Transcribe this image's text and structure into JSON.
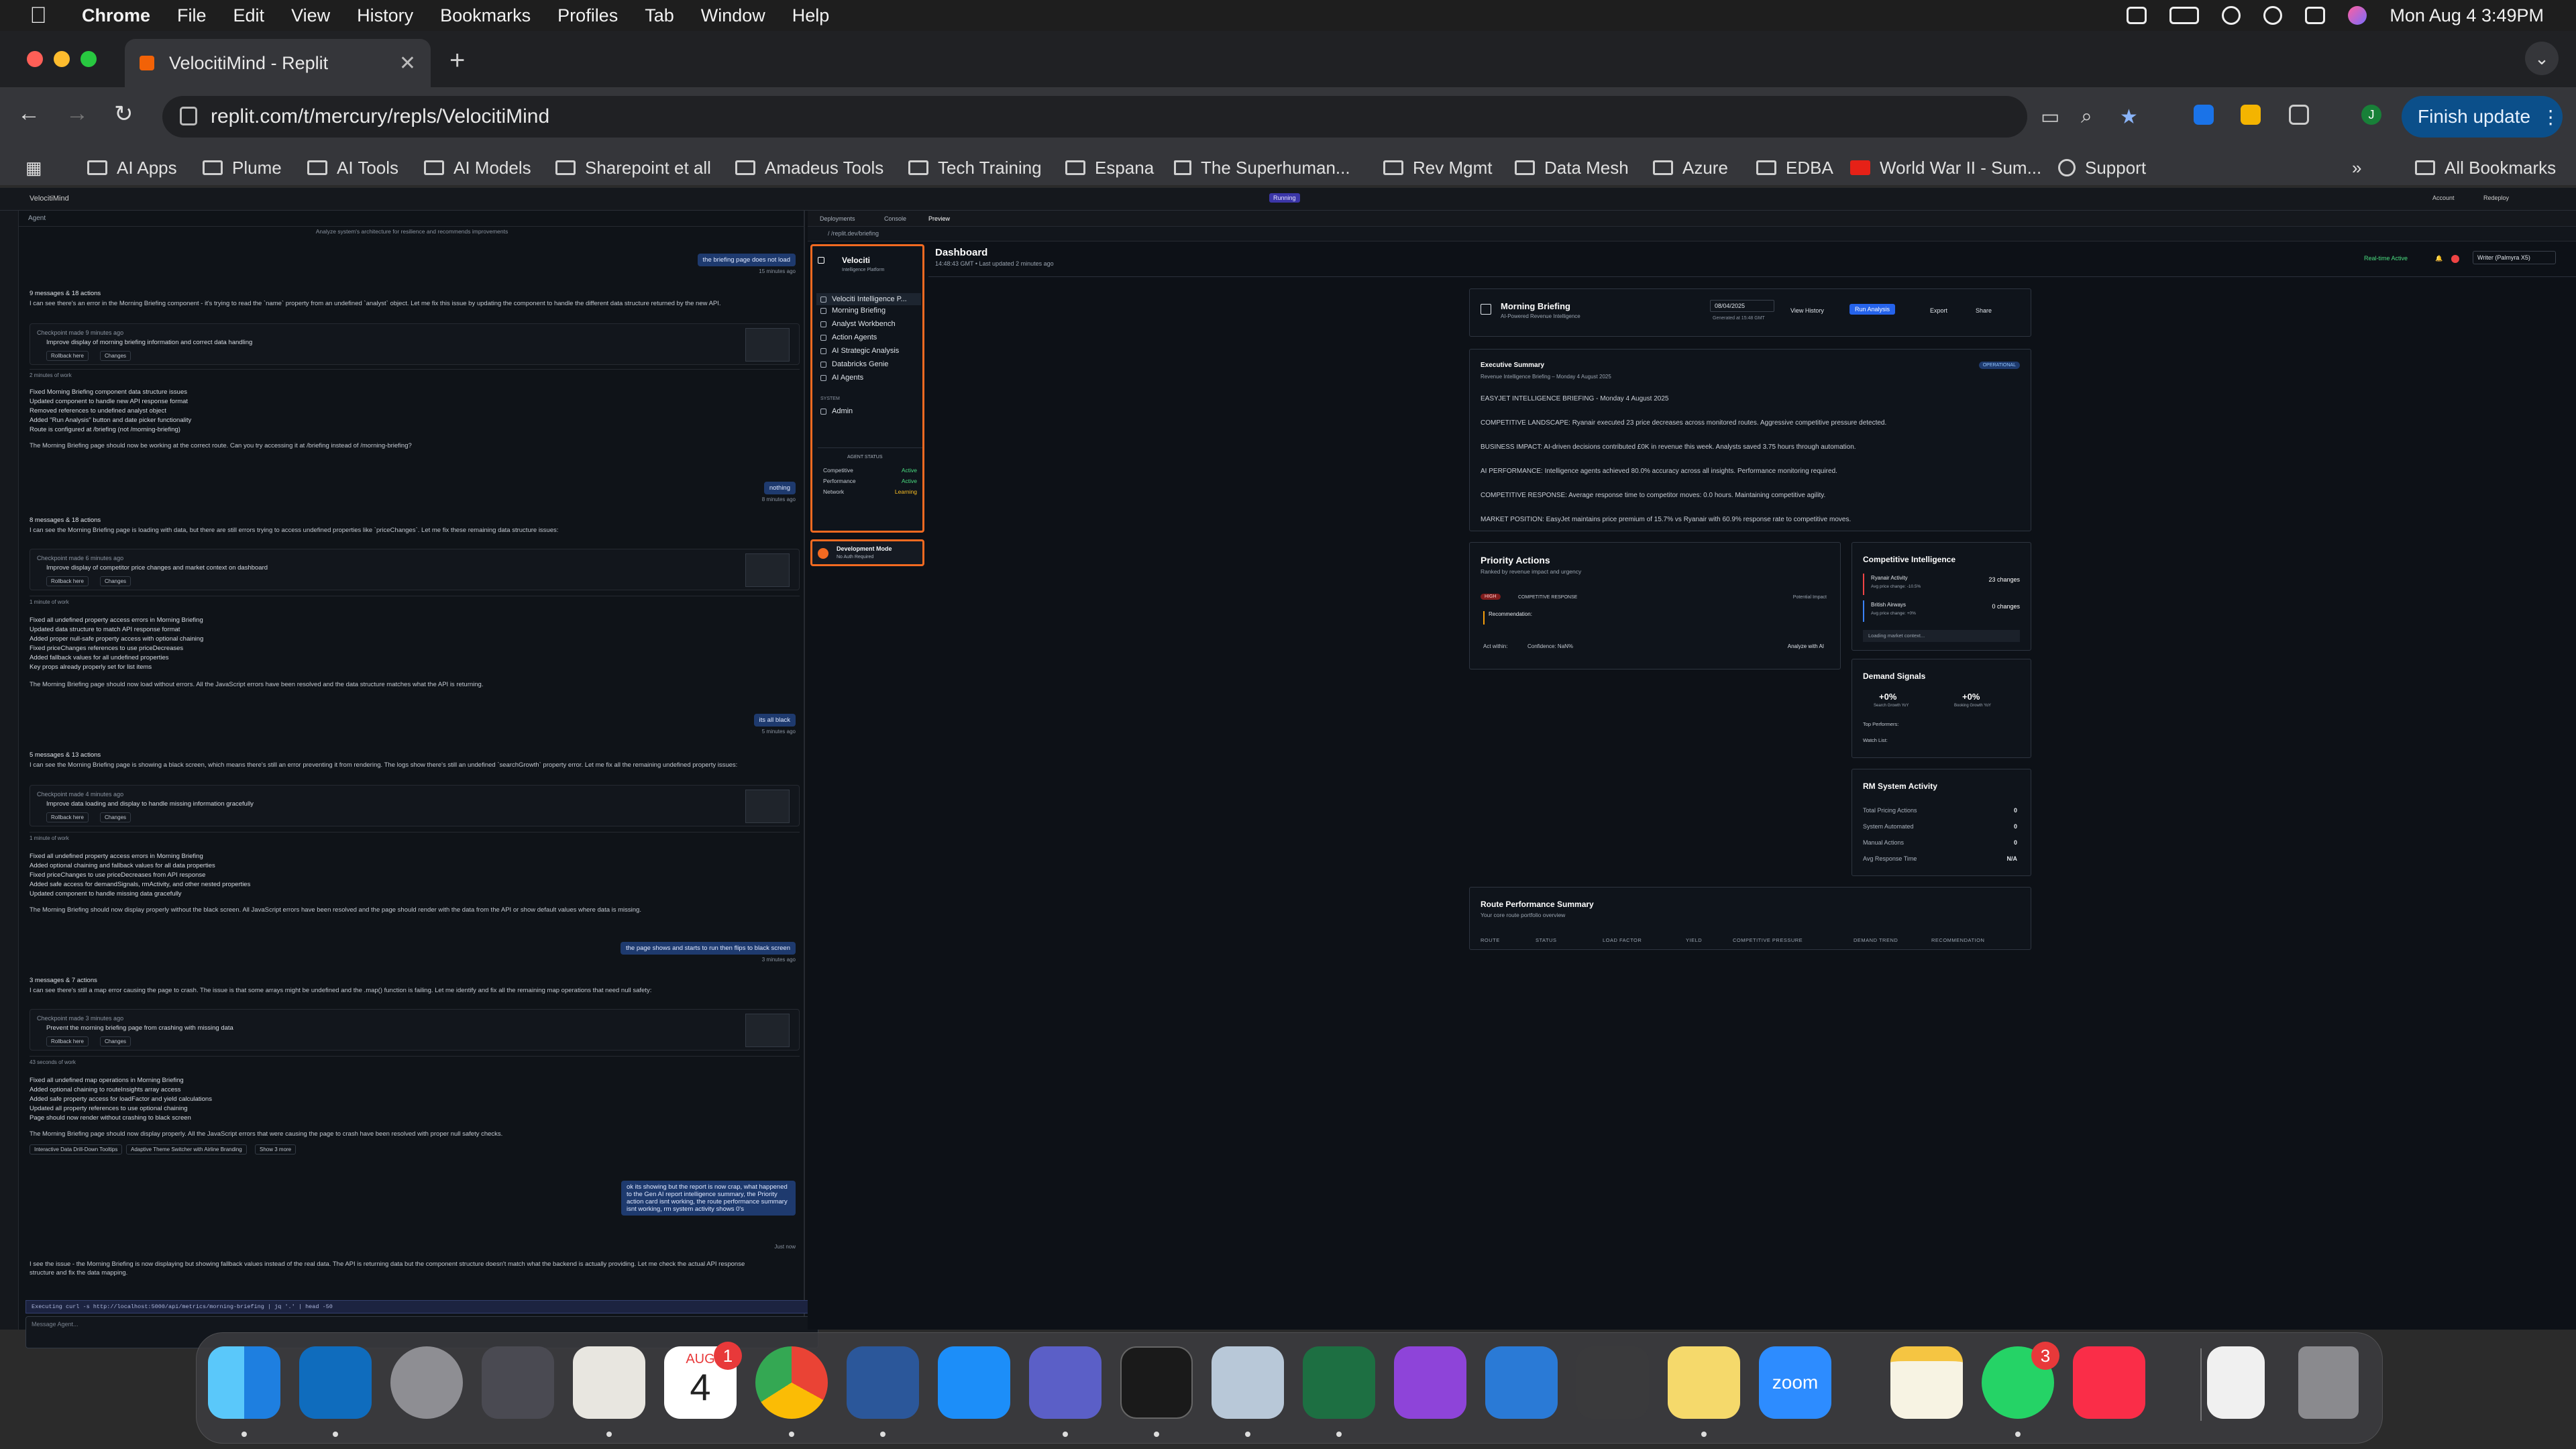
{
  "menubar": {
    "app": "Chrome",
    "items": [
      "File",
      "Edit",
      "View",
      "History",
      "Bookmarks",
      "Profiles",
      "Tab",
      "Window",
      "Help"
    ],
    "datetime": "Mon Aug 4  3:49PM"
  },
  "browser": {
    "tab_title": "VelocitiMind - Replit",
    "url": "replit.com/t/mercury/repls/VelocitiMind",
    "finish_update": "Finish update",
    "profile_initial": "J",
    "bookmarks": [
      "AI Apps",
      "Plume",
      "AI Tools",
      "AI Models",
      "Sharepoint et all",
      "Amadeus Tools",
      "Tech Training",
      "Espana",
      "The Superhuman...",
      "Rev Mgmt",
      "Data Mesh",
      "Azure",
      "EDBA",
      "World War II - Sum...",
      "Support",
      "All Bookmarks"
    ]
  },
  "replit": {
    "project": "VelocitiMind",
    "status": "Running",
    "tabs": [
      "Deployments",
      "Console",
      "Preview"
    ],
    "preview_url": "/ /replit.dev/briefing",
    "top_right": [
      "Account",
      "Redeploy"
    ]
  },
  "agent": {
    "tab": "Agent",
    "header": "Analyze system's architecture for resilience and recommends improvements",
    "msgs": [
      {
        "user": "the briefing page does not load",
        "when": "15 minutes ago"
      },
      {
        "user": "nothing",
        "when": "8 minutes ago"
      },
      {
        "user": "its all black",
        "when": "5 minutes ago"
      },
      {
        "user": "the page shows and starts to run then flips to black screen",
        "when": "3 minutes ago"
      },
      {
        "user": "ok its showing but the report is now crap, what happened to the Gen AI report intelligence summary, the Priority action card isnt working, the route performance summary isnt working, rm system activity shows 0's",
        "when": "Just now"
      }
    ],
    "blocks": [
      {
        "head": "9 messages & 18 actions",
        "text": "I can see there's an error in the Morning Briefing component - it's trying to read the `name` property from an undefined `analyst` object. Let me fix this issue by updating the component to handle the different data structure returned by the new API.",
        "checkpoint": "Checkpoint made 9 minutes ago",
        "cp_desc": "Improve display of morning briefing information and correct data handling",
        "work": "2 minutes of work",
        "list": [
          "Fixed Morning Briefing component data structure issues",
          "Updated component to handle new API response format",
          "Removed references to undefined analyst object",
          "Added \"Run Analysis\" button and date picker functionality",
          "Route is configured at /briefing (not /morning-briefing)"
        ],
        "summary": "The Morning Briefing page should now be working at the correct route. Can you try accessing it at /briefing instead of /morning-briefing?"
      },
      {
        "head": "8 messages & 18 actions",
        "text": "I can see the Morning Briefing page is loading with data, but there are still errors trying to access undefined properties like `priceChanges`. Let me fix these remaining data structure issues:",
        "checkpoint": "Checkpoint made 6 minutes ago",
        "cp_desc": "Improve display of competitor price changes and market context on dashboard",
        "work": "1 minute of work",
        "list": [
          "Fixed all undefined property access errors in Morning Briefing",
          "Updated data structure to match API response format",
          "Added proper null-safe property access with optional chaining",
          "Fixed priceChanges references to use priceDecreases",
          "Added fallback values for all undefined properties",
          "Key props already properly set for list items"
        ],
        "summary": "The Morning Briefing page should now load without errors. All the JavaScript errors have been resolved and the data structure matches what the API is returning."
      },
      {
        "head": "5 messages & 13 actions",
        "text": "I can see the Morning Briefing page is showing a black screen, which means there's still an error preventing it from rendering. The logs show there's still an undefined `searchGrowth` property error. Let me fix all the remaining undefined property issues:",
        "checkpoint": "Checkpoint made 4 minutes ago",
        "cp_desc": "Improve data loading and display to handle missing information gracefully",
        "work": "1 minute of work",
        "list": [
          "Fixed all undefined property access errors in Morning Briefing",
          "Added optional chaining and fallback values for all data properties",
          "Fixed priceChanges to use priceDecreases from API response",
          "Added safe access for demandSignals, rmActivity, and other nested properties",
          "Updated component to handle missing data gracefully"
        ],
        "summary": "The Morning Briefing should now display properly without the black screen. All JavaScript errors have been resolved and the page should render with the data from the API or show default values where data is missing."
      },
      {
        "head": "3 messages & 7 actions",
        "text": "I can see there's still a map error causing the page to crash. The issue is that some arrays might be undefined and the .map() function is failing. Let me identify and fix all the remaining map operations that need null safety:",
        "checkpoint": "Checkpoint made 3 minutes ago",
        "cp_desc": "Prevent the morning briefing page from crashing with missing data",
        "work": "43 seconds of work",
        "list": [
          "Fixed all undefined map operations in Morning Briefing",
          "Added optional chaining to routeInsights array access",
          "Added safe property access for loadFactor and yield calculations",
          "Updated all property references to use optional chaining",
          "Page should now render without crashing to black screen"
        ],
        "summary": "The Morning Briefing page should now display properly. All the JavaScript errors that were causing the page to crash have been resolved with proper null safety checks."
      }
    ],
    "chips": [
      "Interactive Data Drill-Down Tooltips",
      "Adaptive Theme Switcher with Airline Branding",
      "Show 3 more"
    ],
    "rollback": "Rollback here",
    "changes": "Changes",
    "final": "I see the issue - the Morning Briefing is now displaying but showing fallback values instead of the real data. The API is returning data but the component structure doesn't match what the backend is actually providing. Let me check the actual API response structure and fix the data mapping.",
    "running_cmd": "Executing curl -s http://localhost:5000/api/metrics/morning-briefing | jq '.' | head -50",
    "input_placeholder": "Message Agent..."
  },
  "app": {
    "brand": "Velociti",
    "brand_sub": "Intelligence Platform",
    "nav": [
      "Velociti Intelligence P...",
      "Morning Briefing",
      "Analyst Workbench",
      "Action Agents",
      "AI Strategic Analysis",
      "Databricks Genie",
      "AI Agents"
    ],
    "system_label": "SYSTEM",
    "admin": "Admin",
    "agent_status_label": "AGENT STATUS",
    "agents": [
      {
        "name": "Competitive",
        "status": "Active"
      },
      {
        "name": "Performance",
        "status": "Active"
      },
      {
        "name": "Network",
        "status": "Learning"
      }
    ],
    "dev_mode": "Development Mode",
    "dev_sub": "No Auth Required",
    "title": "Dashboard",
    "subtitle": "14:48:43 GMT  •  Last updated 2 minutes ago",
    "realtime": "Real-time Active",
    "writer": "Writer (Palmyra X5)",
    "briefing": {
      "title": "Morning Briefing",
      "sub": "AI-Powered Revenue Intelligence",
      "date": "08/04/2025",
      "generated": "Generated at 15:48 GMT",
      "view_history": "View History",
      "run": "Run Analysis",
      "export": "Export",
      "share": "Share"
    },
    "exec": {
      "title": "Executive Summary",
      "sub": "Revenue Intelligence Briefing – Monday 4 August 2025",
      "badge": "OPERATIONAL",
      "lines": [
        "EASYJET INTELLIGENCE BRIEFING - Monday 4 August 2025",
        "COMPETITIVE LANDSCAPE: Ryanair executed 23 price decreases across monitored routes. Aggressive competitive pressure detected.",
        "BUSINESS IMPACT: AI-driven decisions contributed £0K in revenue this week. Analysts saved 3.75 hours through automation.",
        "AI PERFORMANCE: Intelligence agents achieved 80.0% accuracy across all insights. Performance monitoring required.",
        "COMPETITIVE RESPONSE: Average response time to competitor moves: 0.0 hours. Maintaining competitive agility.",
        "MARKET POSITION: EasyJet maintains price premium of 15.7% vs Ryanair with 60.9% response rate to competitive moves."
      ]
    },
    "priority": {
      "title": "Priority Actions",
      "sub": "Ranked by revenue impact and urgency",
      "tag": "HIGH",
      "kind": "COMPETITIVE RESPONSE",
      "impact": "Potential Impact",
      "rec": "Recommendation:",
      "act": "Act within:",
      "conf": "Confidence: NaN%",
      "analyze": "Analyze with AI"
    },
    "ci": {
      "title": "Competitive Intelligence",
      "rows": [
        {
          "name": "Ryanair Activity",
          "sub": "Avg price change: -10.5%",
          "val": "23 changes"
        },
        {
          "name": "British Airways",
          "sub": "Avg price change: +0%",
          "val": "0 changes"
        }
      ],
      "loading": "Loading market context..."
    },
    "demand": {
      "title": "Demand Signals",
      "m1": "+0%",
      "m1l": "Search Growth YoY",
      "m2": "+0%",
      "m2l": "Booking Growth YoY",
      "top": "Top Performers:",
      "watch": "Watch List:"
    },
    "rm": {
      "title": "RM System Activity",
      "rows": [
        {
          "k": "Total Pricing Actions",
          "v": "0"
        },
        {
          "k": "System Automated",
          "v": "0"
        },
        {
          "k": "Manual Actions",
          "v": "0"
        },
        {
          "k": "Avg Response Time",
          "v": "N/A"
        }
      ]
    },
    "route": {
      "title": "Route Performance Summary",
      "sub": "Your core route portfolio overview",
      "cols": [
        "ROUTE",
        "STATUS",
        "LOAD FACTOR",
        "YIELD",
        "COMPETITIVE PRESSURE",
        "DEMAND TREND",
        "RECOMMENDATION"
      ]
    }
  },
  "dock": {
    "calendar_month": "AUG",
    "calendar_day": "4",
    "calendar_badge": "1",
    "whatsapp_badge": "3",
    "zoom": "zoom"
  }
}
